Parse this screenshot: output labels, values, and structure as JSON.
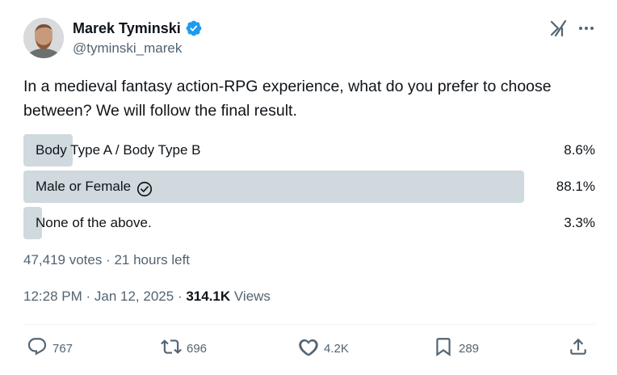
{
  "author": {
    "name": "Marek Tyminski",
    "handle": "@tyminski_marek",
    "verified_color": "#1d9bf0"
  },
  "tweet": {
    "text": "In a medieval fantasy action-RPG experience, what do you prefer to choose between? We will follow the final result."
  },
  "poll": {
    "options": [
      {
        "label": "Body Type A / Body Type B",
        "percent": "8.6%",
        "fraction": 0.086,
        "winner": false
      },
      {
        "label": "Male or Female",
        "percent": "88.1%",
        "fraction": 0.881,
        "winner": true
      },
      {
        "label": "None of the above.",
        "percent": "3.3%",
        "fraction": 0.033,
        "winner": false
      }
    ],
    "votes_text": "47,419 votes · 21 hours left"
  },
  "meta": {
    "time": "12:28 PM",
    "date": "Jan 12, 2025",
    "views_count": "314.1K",
    "views_label": "Views"
  },
  "actions": {
    "replies": "767",
    "reposts": "696",
    "likes": "4.2K",
    "bookmarks": "289"
  },
  "icons": [
    "verified-badge-icon",
    "grok-icon",
    "more-icon",
    "check-circle-icon",
    "reply-icon",
    "repost-icon",
    "like-icon",
    "bookmark-icon",
    "share-icon"
  ],
  "colors": {
    "bar": "#cfd9de",
    "muted": "#536471",
    "text": "#0f1419"
  }
}
